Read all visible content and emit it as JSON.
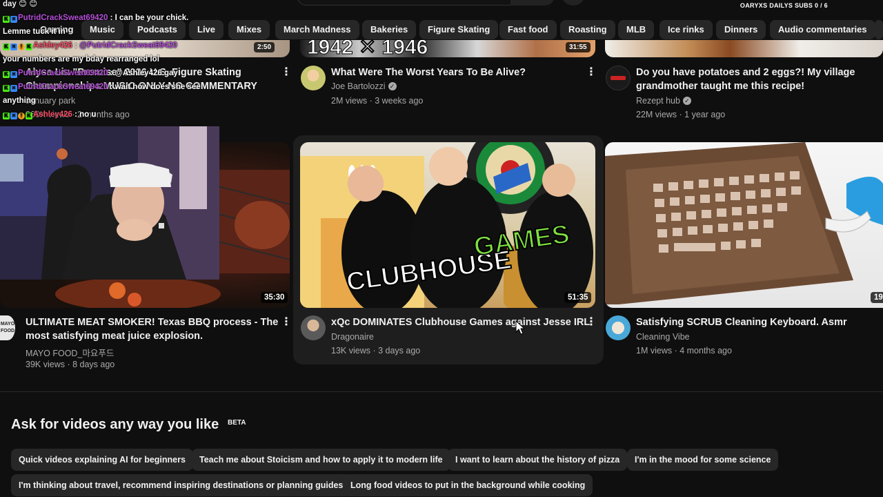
{
  "overlay": {
    "subs_counter": "OARYXS DAILYS SUBS 0 / 6",
    "chat_top_fragment": "day 😊 😊",
    "chat": [
      {
        "name": "PutridCrackSweat69420",
        "name_color": "#b54fd8",
        "msg": "I can be your chick."
      },
      {
        "name": "",
        "name_color": "#ffffff",
        "msg": "Lemme tuck it in"
      },
      {
        "name": "Ashley426",
        "name_color": "#ff4d6a",
        "msg": "@PutridCrackSweat69420"
      },
      {
        "name": "",
        "name_color": "#ffffff",
        "msg": "your numbers are my bday rearranged lol"
      },
      {
        "name": "PutridCrackSweat69420",
        "name_color": "#b54fd8",
        "msg": "@Ashley426 gay"
      },
      {
        "name": "PutridCrackSweat69420",
        "name_color": "#b54fd8",
        "msg": "wait how does she see"
      },
      {
        "name": "",
        "name_color": "#ffffff",
        "msg": "anything"
      },
      {
        "name": "Ashley426",
        "name_color": "#ff4d6a",
        "msg": "no u"
      }
    ]
  },
  "chips": [
    "Gaming",
    "Music",
    "Podcasts",
    "Live",
    "Mixes",
    "March Madness",
    "Bakeries",
    "Figure Skating",
    "Fast food",
    "Roasting",
    "MLB",
    "Ice rinks",
    "Dinners",
    "Audio commentaries"
  ],
  "row1": [
    {
      "title1": "Alysa Liu \"Promise\" 2026 U.S. Figure Skating",
      "title2": "Championships MUSIC ONLY NO COMMENTARY",
      "channel": "January park",
      "meta": "260K views · 2 months ago",
      "duration": "2:50"
    },
    {
      "title1": "What Were The Worst Years To Be Alive?",
      "title2": "",
      "channel": "Joe Bartolozzi",
      "verified": true,
      "meta": "2M views · 3 weeks ago",
      "duration": "31:55"
    },
    {
      "title1": "Do you have potatoes and 2 eggs?! My village",
      "title2": "grandmother taught me this recipe!",
      "channel": "Rezept hub",
      "verified": true,
      "meta": "22M views · 1 year ago"
    }
  ],
  "row2": [
    {
      "title1": "ULTIMATE MEAT SMOKER! Texas BBQ process - The",
      "title2": "most satisfying meat juice explosion.",
      "channel": "MAYO FOOD_마요푸드",
      "meta": "39K views · 8 days ago",
      "duration": "35:30"
    },
    {
      "title1": "xQc DOMINATES Clubhouse Games against Jesse IRL",
      "title2": "",
      "channel": "Dragonaire",
      "meta": "13K views · 3 days ago",
      "duration": "51:35",
      "thumb_text1": "CLUBHOUSE",
      "thumb_text2": "GAMES"
    },
    {
      "title1": "Satisfying SCRUB Cleaning Keyboard. Asmr",
      "title2": "",
      "channel": "Cleaning Vibe",
      "meta": "1M views · 4 months ago",
      "duration": "19"
    }
  ],
  "ask": {
    "title": "Ask for videos any way you like",
    "beta": "BETA",
    "prompts": [
      "Quick videos explaining AI for beginners",
      "Teach me about Stoicism and how to apply it to modern life",
      "I want to learn about the history of pizza",
      "I'm in the mood for some science",
      "I'm thinking about travel, recommend inspiring destinations or planning guides",
      "Long food videos to put in the background while cooking"
    ]
  }
}
